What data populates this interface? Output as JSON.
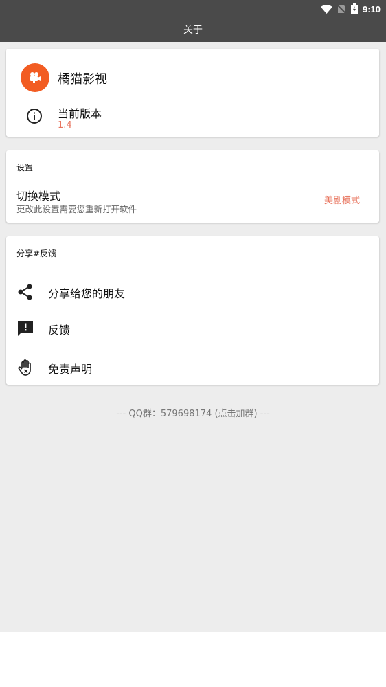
{
  "status_bar": {
    "time": "9:10",
    "icons": [
      "wifi-icon",
      "no-sim-icon",
      "battery-charging-icon"
    ]
  },
  "header": {
    "title": "关于"
  },
  "app_card": {
    "app_icon": "video-camera-icon",
    "app_name": "橘猫影视",
    "version_icon": "info-icon",
    "version_label": "当前版本",
    "version_value": "1.4"
  },
  "settings": {
    "section_title": "设置",
    "mode_title": "切换模式",
    "mode_description": "更改此设置需要您重新打开软件",
    "mode_value": "美剧模式"
  },
  "share_feedback": {
    "section_title": "分享#反馈",
    "items": [
      {
        "icon": "share-icon",
        "label": "分享给您的朋友"
      },
      {
        "icon": "feedback-icon",
        "label": "反馈"
      },
      {
        "icon": "disclaimer-hand-icon",
        "label": "免责声明"
      }
    ]
  },
  "footer": {
    "qq_text": "--- QQ群：579698174 (点击加群) ---"
  },
  "colors": {
    "app_bar": "#4a4a4a",
    "accent": "#e8745e",
    "app_icon_bg": "#f25c22",
    "background": "#ededed"
  }
}
